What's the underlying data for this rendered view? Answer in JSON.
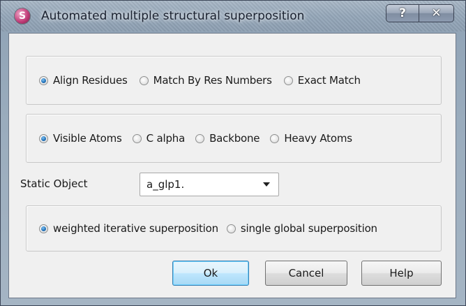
{
  "window": {
    "title": "Automated multiple structural superposition",
    "app_icon_glyph": "S",
    "help_glyph": "?",
    "close_glyph": "✕"
  },
  "alignment_mode": {
    "options": [
      "Align Residues",
      "Match By Res Numbers",
      "Exact Match"
    ],
    "selected": "Align Residues"
  },
  "atom_selection": {
    "options": [
      "Visible Atoms",
      "C alpha",
      "Backbone",
      "Heavy Atoms"
    ],
    "selected": "Visible Atoms"
  },
  "static_object": {
    "label": "Static Object",
    "value": "a_glp1."
  },
  "superposition_method": {
    "options": [
      "weighted iterative superposition",
      "single global superposition"
    ],
    "selected": "weighted iterative superposition"
  },
  "buttons": {
    "ok": "Ok",
    "cancel": "Cancel",
    "help": "Help"
  },
  "colors": {
    "accent": "#1f6fb7",
    "default_button_border": "#3c7fb1"
  },
  "icons": {
    "app": "app-logo-icon",
    "help": "question-mark-icon",
    "close": "close-icon",
    "dropdown": "chevron-down-icon"
  }
}
